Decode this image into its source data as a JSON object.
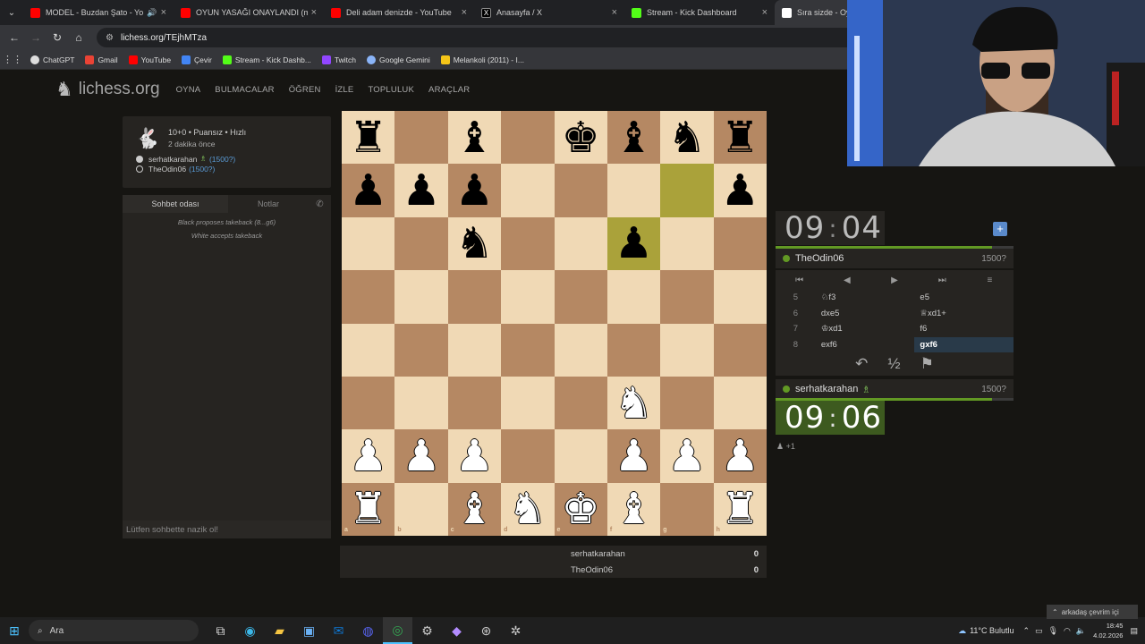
{
  "browser": {
    "tabs": [
      {
        "title": "MODEL - Buzdan Şato - Yo",
        "icon": "youtube-icon",
        "color": "#ff0000"
      },
      {
        "title": "OYUN YASAĞI ONAYLANDI (m",
        "icon": "youtube-icon",
        "color": "#ff0000"
      },
      {
        "title": "Deli adam denizde - YouTube",
        "icon": "youtube-icon",
        "color": "#ff0000"
      },
      {
        "title": "Anasayfa / X",
        "icon": "x-icon",
        "color": "#000000"
      },
      {
        "title": "Stream - Kick Dashboard",
        "icon": "kick-icon",
        "color": "#53fc18"
      },
      {
        "title": "Sıra sizde - Oyna TheOdin0",
        "icon": "lichess-icon",
        "color": "#ffffff"
      }
    ],
    "url": "lichess.org/TEjhMTza",
    "bookmarks": [
      "ChatGPT",
      "Gmail",
      "YouTube",
      "Çevir",
      "Stream - Kick Dashb...",
      "Twitch",
      "Google Gemini",
      "Melankoli (2011) - I..."
    ]
  },
  "lichess": {
    "logo": "lichess.org",
    "menu": [
      "OYNA",
      "BULMACALAR",
      "ÖĞREN",
      "İZLE",
      "TOPLULUK",
      "ARAÇLAR"
    ],
    "game": {
      "info": "10+0 • Puansız • Hızlı",
      "time_ago": "2 dakika önce",
      "white": "serhatkarahan",
      "white_rating": "(1500?)",
      "black": "TheOdin06",
      "black_rating": "(1500?)"
    },
    "chat": {
      "tab_room": "Sohbet odası",
      "tab_notes": "Notlar",
      "messages": [
        "Black proposes takeback (8...g6)",
        "White accepts takeback"
      ],
      "placeholder": "Lütfen sohbette nazik ol!"
    },
    "board": {
      "files": [
        "a",
        "b",
        "c",
        "d",
        "e",
        "f",
        "g",
        "h"
      ],
      "ranks": [
        "8",
        "7",
        "6",
        "5",
        "4",
        "3",
        "2",
        "1"
      ],
      "pieces": [
        [
          "br",
          "",
          "bb",
          "",
          "bk",
          "bb",
          "bn",
          "br"
        ],
        [
          "bp",
          "bp",
          "bp",
          "",
          "",
          "",
          "",
          "bp"
        ],
        [
          "",
          "",
          "bn",
          "",
          "",
          "bp",
          "",
          ""
        ],
        [
          "",
          "",
          "",
          "",
          "",
          "",
          "",
          ""
        ],
        [
          "",
          "",
          "",
          "",
          "",
          "",
          "",
          ""
        ],
        [
          "",
          "",
          "",
          "",
          "",
          "wn",
          "",
          ""
        ],
        [
          "wp",
          "wp",
          "wp",
          "",
          "",
          "wp",
          "wp",
          "wp"
        ],
        [
          "wr",
          "",
          "wb",
          "wn",
          "wk",
          "wb",
          "",
          "wr"
        ]
      ],
      "highlights": [
        "g7",
        "f6"
      ]
    },
    "scores": [
      {
        "name": "serhatkarahan",
        "score": "0"
      },
      {
        "name": "TheOdin06",
        "score": "0"
      }
    ],
    "clock_top": {
      "min": "09",
      "sec": "04"
    },
    "clock_bottom": {
      "min": "09",
      "sec": "06"
    },
    "opponent": {
      "name": "TheOdin06",
      "rating": "1500?"
    },
    "player": {
      "name": "serhatkarahan",
      "rating": "1500?"
    },
    "moves": [
      {
        "n": "5",
        "w": "♘f3",
        "b": "e5"
      },
      {
        "n": "6",
        "w": "dxe5",
        "b": "♕xd1+"
      },
      {
        "n": "7",
        "w": "♔xd1",
        "b": "f6"
      },
      {
        "n": "8",
        "w": "exf6",
        "b": "gxf6"
      }
    ],
    "pawn_bonus": "+1"
  },
  "taskbar": {
    "search": "Ara",
    "weather": "11°C  Bulutlu",
    "time": "18:45",
    "date": "4.02.2026",
    "notice": "arkadaş çevrim içi"
  }
}
